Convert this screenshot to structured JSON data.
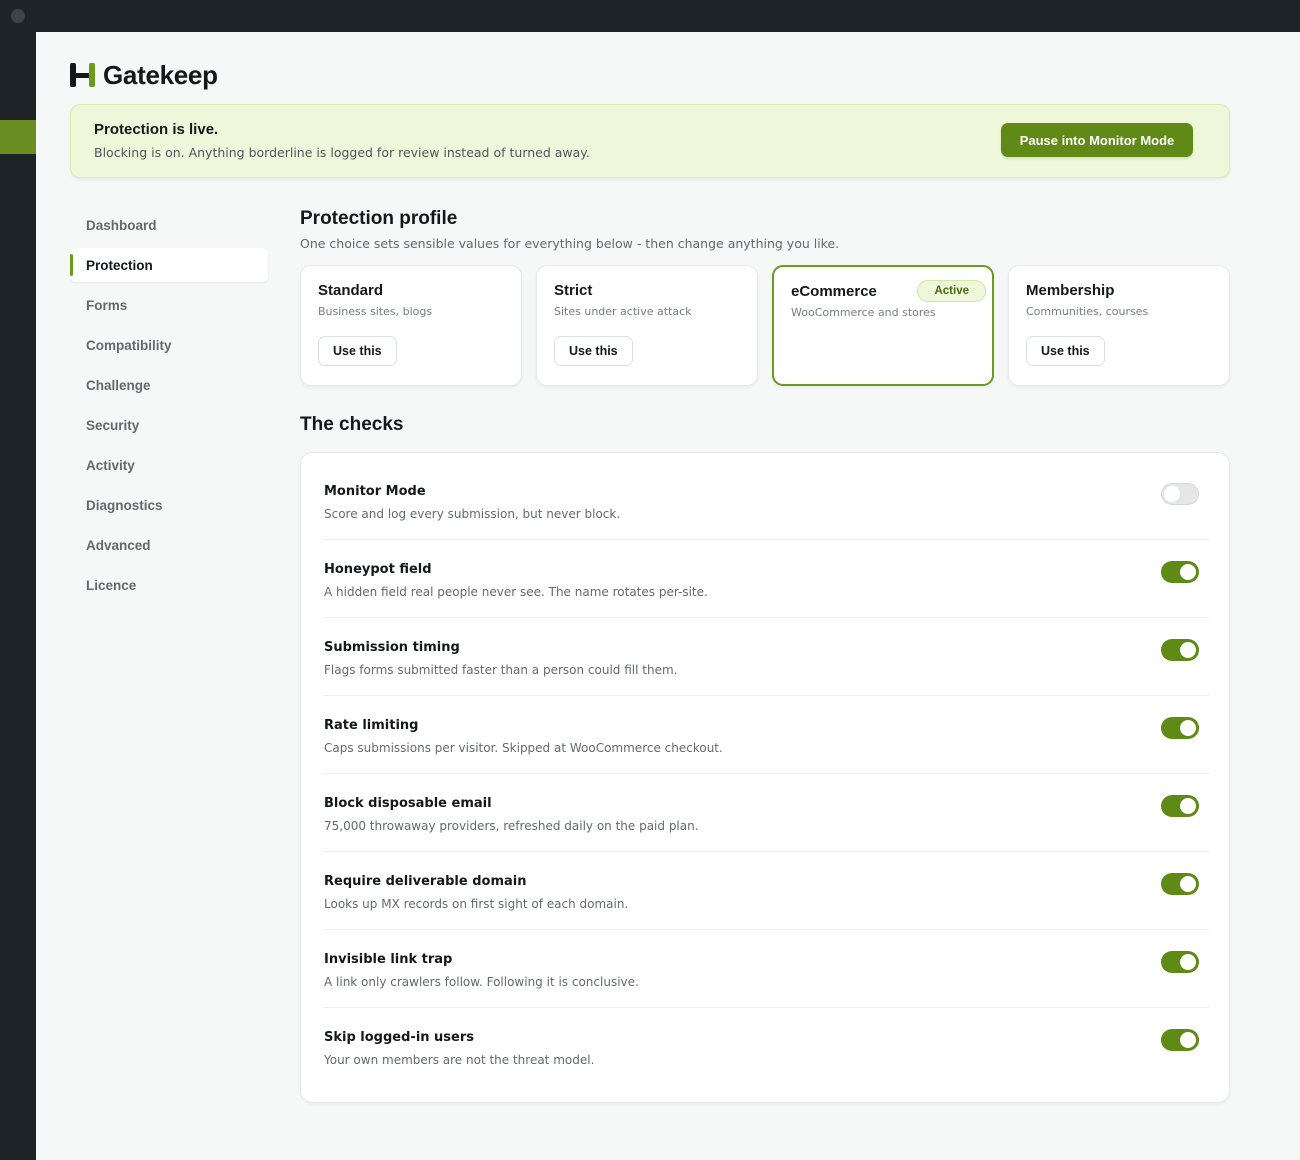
{
  "brand": {
    "name": "Gatekeep"
  },
  "banner": {
    "title": "Protection is live.",
    "text": "Blocking is on. Anything borderline is logged for review instead of turned away.",
    "button_label": "Pause into Monitor Mode"
  },
  "nav": {
    "items": [
      {
        "label": "Dashboard",
        "active": false
      },
      {
        "label": "Protection",
        "active": true
      },
      {
        "label": "Forms",
        "active": false
      },
      {
        "label": "Compatibility",
        "active": false
      },
      {
        "label": "Challenge",
        "active": false
      },
      {
        "label": "Security",
        "active": false
      },
      {
        "label": "Activity",
        "active": false
      },
      {
        "label": "Diagnostics",
        "active": false
      },
      {
        "label": "Advanced",
        "active": false
      },
      {
        "label": "Licence",
        "active": false
      }
    ]
  },
  "profile": {
    "title": "Protection profile",
    "subtitle": "One choice sets sensible values for everything below - then change anything you like.",
    "cards": [
      {
        "name": "Standard",
        "desc": "Business sites, blogs",
        "button": "Use this",
        "active": false
      },
      {
        "name": "Strict",
        "desc": "Sites under active attack",
        "button": "Use this",
        "active": false
      },
      {
        "name": "eCommerce",
        "desc": "WooCommerce and stores",
        "badge": "Active",
        "active": true
      },
      {
        "name": "Membership",
        "desc": "Communities, courses",
        "button": "Use this",
        "active": false
      }
    ]
  },
  "checks": {
    "title": "The checks",
    "items": [
      {
        "title": "Monitor Mode",
        "desc": "Score and log every submission, but never block.",
        "enabled": false
      },
      {
        "title": "Honeypot field",
        "desc": "A hidden field real people never see. The name rotates per-site.",
        "enabled": true
      },
      {
        "title": "Submission timing",
        "desc": "Flags forms submitted faster than a person could fill them.",
        "enabled": true
      },
      {
        "title": "Rate limiting",
        "desc": "Caps submissions per visitor. Skipped at WooCommerce checkout.",
        "enabled": true
      },
      {
        "title": "Block disposable email",
        "desc": "75,000 throwaway providers, refreshed daily on the paid plan.",
        "enabled": true
      },
      {
        "title": "Require deliverable domain",
        "desc": "Looks up MX records on first sight of each domain.",
        "enabled": true
      },
      {
        "title": "Invisible link trap",
        "desc": "A link only crawlers follow. Following it is conclusive.",
        "enabled": true
      },
      {
        "title": "Skip logged-in users",
        "desc": "Your own members are not the threat model.",
        "enabled": true
      }
    ]
  },
  "colors": {
    "accent": "#5f8a16",
    "banner_bg": "#eef7da",
    "text": "#14181b",
    "muted": "#646970"
  }
}
